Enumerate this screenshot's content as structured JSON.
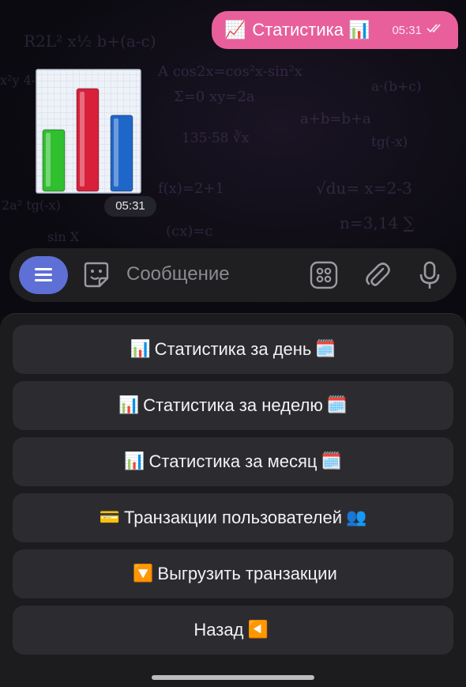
{
  "message": {
    "emoji_left": "📈",
    "text": "Статистика",
    "emoji_right": "📊",
    "time": "05:31",
    "status_icon": "double-check-icon"
  },
  "sticker": {
    "bar_colors": [
      "#2fbf2f",
      "#d8203a",
      "#1f66c9"
    ],
    "bar_levels": [
      0.6,
      1.0,
      0.74
    ],
    "time": "05:31"
  },
  "input": {
    "placeholder": "Сообщение",
    "icons": [
      "menu-icon",
      "sticker-icon",
      "keyboard-grid-icon",
      "paperclip-icon",
      "microphone-icon"
    ],
    "accent": "#5e6fd6"
  },
  "keyboard": {
    "buttons": [
      {
        "prefix": "📊",
        "label": "Статистика за день",
        "suffix": "🗓️"
      },
      {
        "prefix": "📊",
        "label": "Статистика за неделю",
        "suffix": "🗓️"
      },
      {
        "prefix": "📊",
        "label": "Статистика за месяц",
        "suffix": "🗓️"
      },
      {
        "prefix": "💳",
        "label": "Транзакции пользователей",
        "suffix": "👥"
      },
      {
        "prefix": "🔽",
        "label": "Выгрузить транзакции",
        "suffix": ""
      },
      {
        "prefix": "",
        "label": "Назад",
        "suffix": "◀️"
      }
    ]
  }
}
